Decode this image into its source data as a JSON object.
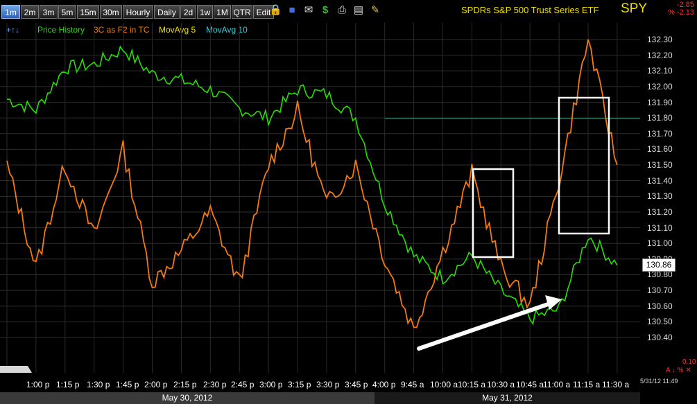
{
  "toolbar": {
    "buttons": [
      "1m",
      "2m",
      "3m",
      "5m",
      "15m",
      "30m",
      "Hourly",
      "Daily",
      "2d",
      "1w",
      "1M",
      "QTR",
      "Edit"
    ],
    "active": "1m",
    "icons": [
      "lock-icon",
      "save-icon",
      "email-icon",
      "dollar-icon",
      "print-icon",
      "card-icon",
      "pencil-icon"
    ]
  },
  "header": {
    "title": "SPDRs S&P 500 Trust Series ETF",
    "symbol": "SPY",
    "change": "-2.85",
    "change_pct": "% -2.13"
  },
  "legend": {
    "arrows": "+↑↓",
    "items": [
      {
        "label": "Price History",
        "color": "#25e000"
      },
      {
        "label": "3C as F2 in TC",
        "color": "#f47a10"
      },
      {
        "label": "MovAvg 5",
        "color": "#f0e000"
      },
      {
        "label": "MovAvg 10",
        "color": "#35d0d8"
      }
    ]
  },
  "y_axis": {
    "ticks": [
      "132.30",
      "132.20",
      "132.10",
      "132.00",
      "131.90",
      "131.80",
      "131.70",
      "131.60",
      "131.50",
      "131.40",
      "131.30",
      "131.20",
      "131.10",
      "131.00",
      "130.90",
      "130.80",
      "130.70",
      "130.60",
      "130.50",
      "130.40"
    ],
    "last_price": "130.86",
    "bottom_value": "0.10",
    "bottom_labels": "A ↓ % ✕"
  },
  "x_axis": {
    "labels": [
      "1:00 p",
      "1:15 p",
      "1:30 p",
      "1:45 p",
      "2:00 p",
      "2:15 p",
      "2:30 p",
      "2:45 p",
      "3:00 p",
      "3:15 p",
      "3:30 p",
      "3:45 p",
      "4:00 p",
      "9:45 a",
      "10:00 a",
      "10:15 a",
      "10:30 a",
      "10:45 a",
      "11:00 a",
      "11:15 a",
      "11:30 a"
    ],
    "timestamp": "5/31/12 11:49"
  },
  "dates": [
    "May 30, 2012",
    "May 31, 2012"
  ],
  "colors": {
    "price": "#25e000",
    "indicator": "#f47a10",
    "grid": "#3a3a3a",
    "accent_line": "#1f8a6a",
    "annotation": "#ffffff"
  },
  "chart_data": {
    "type": "line",
    "series": [
      {
        "name": "Price History",
        "x": [
          "1:00 p",
          "1:15 p",
          "1:30 p",
          "1:45 p",
          "2:00 p",
          "2:15 p",
          "2:30 p",
          "2:45 p",
          "3:00 p",
          "3:15 p",
          "3:30 p",
          "3:45 p",
          "4:00 p",
          "9:45 a",
          "10:00 a",
          "10:15 a",
          "10:30 a",
          "10:45 a",
          "11:00 a",
          "11:15 a",
          "11:30 a",
          "11:45 a"
        ],
        "values": [
          131.92,
          131.85,
          132.12,
          132.14,
          132.24,
          132.08,
          132.04,
          131.98,
          131.86,
          131.8,
          131.98,
          131.95,
          131.8,
          131.26,
          130.92,
          130.78,
          130.92,
          130.7,
          130.52,
          130.58,
          131.05,
          130.86
        ]
      },
      {
        "name": "3C as F2 in TC",
        "x": [
          "1:00 p",
          "1:15 p",
          "1:30 p",
          "1:45 p",
          "2:00 p",
          "2:15 p",
          "2:30 p",
          "2:45 p",
          "3:00 p",
          "3:15 p",
          "3:30 p",
          "3:45 p",
          "4:00 p",
          "9:45 a",
          "10:00 a",
          "10:15 a",
          "10:30 a",
          "10:45 a",
          "11:00 a",
          "11:15 a",
          "11:30 a",
          "11:45 a"
        ],
        "values": [
          131.5,
          130.85,
          131.5,
          131.05,
          131.6,
          130.75,
          130.95,
          131.2,
          130.75,
          131.5,
          131.85,
          131.25,
          131.5,
          130.9,
          130.45,
          130.95,
          131.45,
          130.85,
          130.6,
          131.4,
          132.3,
          131.5
        ]
      }
    ],
    "ylim": [
      130.3,
      132.35
    ],
    "grid": true,
    "annotations": [
      "box around 10:15-10:30 a",
      "box around 11:00-11:15 a",
      "arrow from 9:45 a lows to 11:00 a lows"
    ]
  }
}
